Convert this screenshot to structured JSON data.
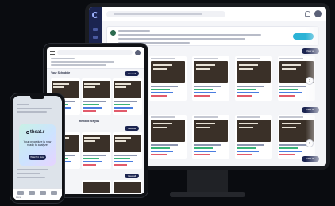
{
  "desktop": {
    "view_all_label": "View all",
    "next_arrow": "›",
    "section_title": "h you",
    "rows": [
      {
        "cards": 5
      },
      {
        "cards": 5
      },
      {
        "cards": 5
      }
    ]
  },
  "tablet": {
    "section_title_1": "Your Schedule",
    "section_title_2": "mended for you",
    "view_all_label": "View all"
  },
  "phone": {
    "brand": "theat.r",
    "message": "Your procedure is now ready to analyze",
    "button_label": "Watch it Now",
    "tabs": [
      "Home",
      "",
      "",
      ""
    ]
  },
  "colors": {
    "navy": "#1b2450",
    "accent": "#2bb3d6",
    "green": "#39b37a",
    "red": "#e25a6b"
  }
}
